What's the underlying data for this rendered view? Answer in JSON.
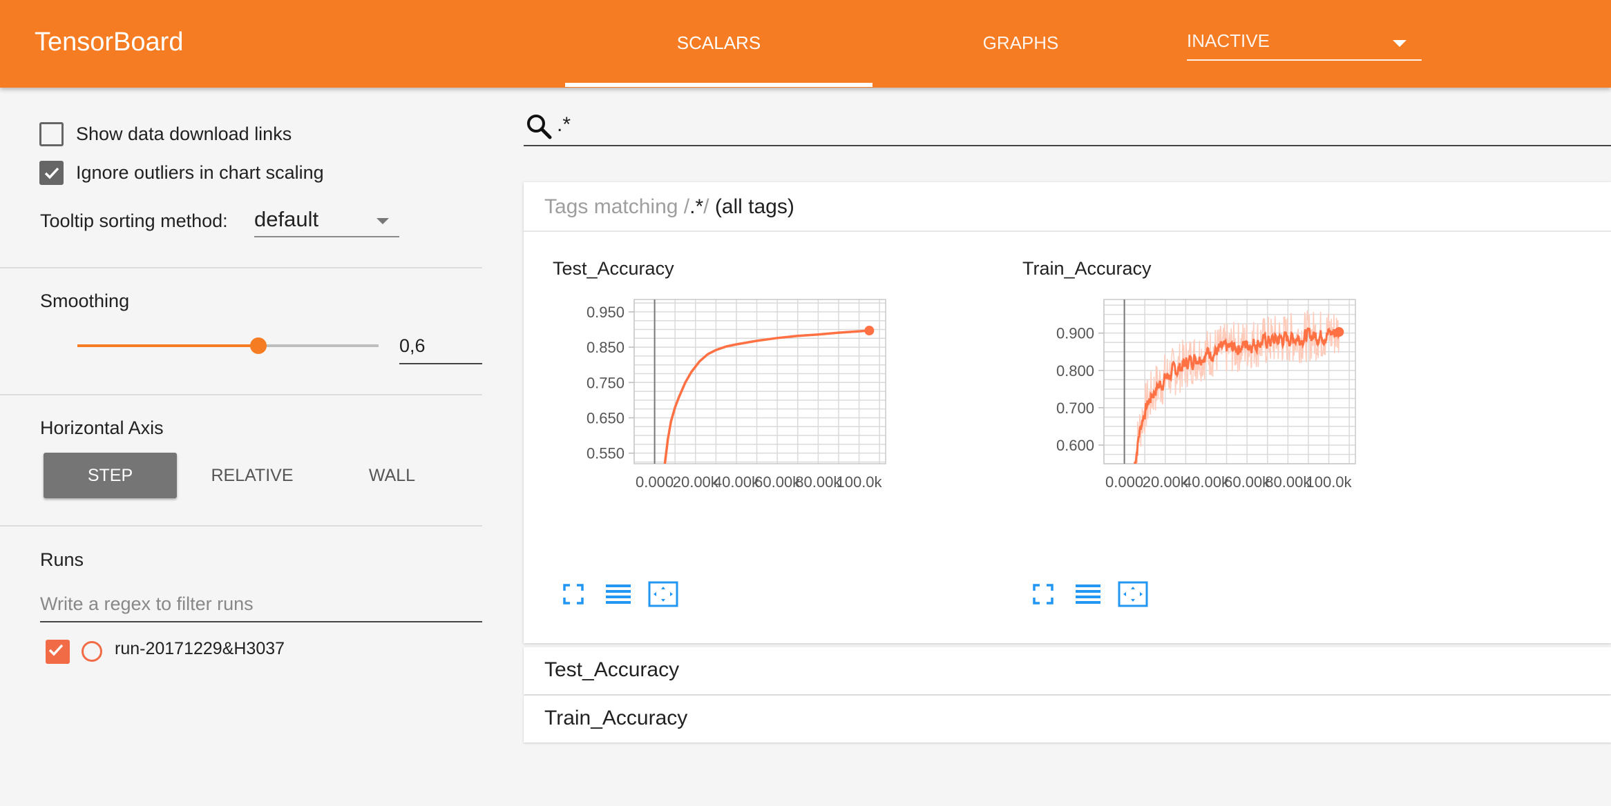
{
  "header": {
    "title": "TensorBoard",
    "tabs": [
      {
        "label": "SCALARS",
        "active": true
      },
      {
        "label": "GRAPHS",
        "active": false
      }
    ],
    "inactive_select": {
      "value": "INACTIVE"
    },
    "color": "#f57c22"
  },
  "sidebar": {
    "show_download_links": {
      "label": "Show data download links",
      "checked": false
    },
    "ignore_outliers": {
      "label": "Ignore outliers in chart scaling",
      "checked": true
    },
    "tooltip_sorting": {
      "label": "Tooltip sorting method:",
      "value": "default"
    },
    "smoothing": {
      "label": "Smoothing",
      "value": 0.6,
      "display": "0,6"
    },
    "horizontal_axis": {
      "label": "Horizontal Axis",
      "options": [
        "STEP",
        "RELATIVE",
        "WALL"
      ],
      "selected": "STEP"
    },
    "runs": {
      "label": "Runs",
      "filter_placeholder": "Write a regex to filter runs",
      "items": [
        {
          "name": "run-20171229&H3037",
          "checked": true,
          "color": "#f26b47"
        }
      ]
    }
  },
  "main": {
    "search": {
      "value": ".*"
    },
    "tags_header": {
      "prefix": "Tags matching /",
      "regex": ".*",
      "suffix": "/",
      "note": "(all tags)"
    },
    "sections": [
      {
        "label": "Test_Accuracy"
      },
      {
        "label": "Train_Accuracy"
      }
    ]
  },
  "chart_data": [
    {
      "type": "line",
      "title": "Test_Accuracy",
      "xlabel": "",
      "ylabel": "",
      "x_ticks": [
        "0.000",
        "20.00k",
        "40.00k",
        "60.00k",
        "80.00k",
        "100.0k"
      ],
      "y_ticks": [
        "0.950",
        "0.850",
        "0.750",
        "0.650",
        "0.550"
      ],
      "xlim": [
        -10000,
        113000
      ],
      "ylim": [
        0.52,
        0.985
      ],
      "grid": true,
      "series_color": "#ff7043",
      "series": [
        {
          "x": [
            5000,
            6500,
            8000,
            10000,
            12000,
            15000,
            18000,
            22000,
            26000,
            30000,
            35000,
            40000,
            50000,
            60000,
            70000,
            80000,
            90000,
            100000,
            105000
          ],
          "y": [
            0.52,
            0.59,
            0.64,
            0.68,
            0.71,
            0.75,
            0.78,
            0.81,
            0.83,
            0.842,
            0.852,
            0.858,
            0.868,
            0.876,
            0.882,
            0.886,
            0.891,
            0.895,
            0.897
          ]
        }
      ]
    },
    {
      "type": "line",
      "title": "Train_Accuracy",
      "xlabel": "",
      "ylabel": "",
      "x_ticks": [
        "0.000",
        "20.00k",
        "40.00k",
        "60.00k",
        "80.00k",
        "100.0k"
      ],
      "y_ticks": [
        "0.900",
        "0.800",
        "0.700",
        "0.600"
      ],
      "xlim": [
        -10000,
        113000
      ],
      "ylim": [
        0.55,
        0.99
      ],
      "grid": true,
      "series_color": "#ff7043",
      "raw_color": "#ffccbc",
      "series": [
        {
          "name": "smoothed",
          "x": [
            5000,
            7000,
            9000,
            12000,
            15000,
            20000,
            25000,
            30000,
            35000,
            40000,
            45000,
            50000,
            55000,
            60000,
            65000,
            70000,
            75000,
            80000,
            85000,
            90000,
            95000,
            100000,
            105000
          ],
          "y": [
            0.55,
            0.63,
            0.68,
            0.72,
            0.75,
            0.78,
            0.8,
            0.82,
            0.835,
            0.845,
            0.852,
            0.858,
            0.862,
            0.87,
            0.875,
            0.878,
            0.883,
            0.886,
            0.889,
            0.892,
            0.895,
            0.898,
            0.903
          ]
        }
      ]
    }
  ]
}
